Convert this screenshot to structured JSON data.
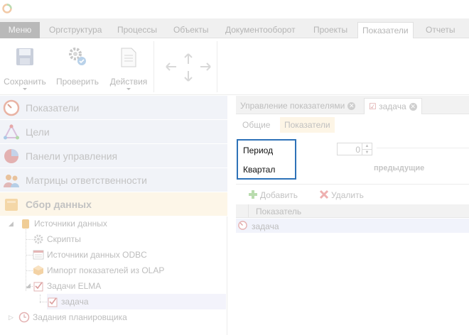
{
  "menubar": {
    "menu_label": "Меню",
    "tabs": [
      "Оргструктура",
      "Процессы",
      "Объекты",
      "Документооборот",
      "Проекты",
      "Показатели",
      "Отчеты"
    ],
    "active_tab": "Показатели"
  },
  "ribbon": {
    "save_label": "Сохранить",
    "check_label": "Проверить",
    "actions_label": "Действия"
  },
  "left_panel": {
    "sections": [
      {
        "label": "Показатели",
        "icon": "speedometer-icon"
      },
      {
        "label": "Цели",
        "icon": "goals-triangle-icon"
      },
      {
        "label": "Панели управления",
        "icon": "pie-chart-icon"
      },
      {
        "label": "Матрицы ответственности",
        "icon": "people-icon"
      },
      {
        "label": "Сбор данных",
        "icon": "data-collection-icon"
      }
    ],
    "tree": {
      "data_sources": "Источники данных",
      "scripts": "Скрипты",
      "odbc": "Источники данных ODBC",
      "olap": "Импорт показателей из OLAP",
      "elma_tasks": "Задачи ELMA",
      "task": "задача",
      "scheduler": "Задания планировщика"
    }
  },
  "right_panel": {
    "doc_tabs": [
      "Управление показателями",
      "задача"
    ],
    "sub_tabs": [
      "Общие",
      "Показатели"
    ],
    "period_label": "Период",
    "quarter_label": "Квартал",
    "spin_value": "0",
    "previous_label": "предыдущие",
    "add_label": "Добавить",
    "delete_label": "Удалить",
    "grid_header": "Показатель",
    "grid_row": "задача"
  }
}
